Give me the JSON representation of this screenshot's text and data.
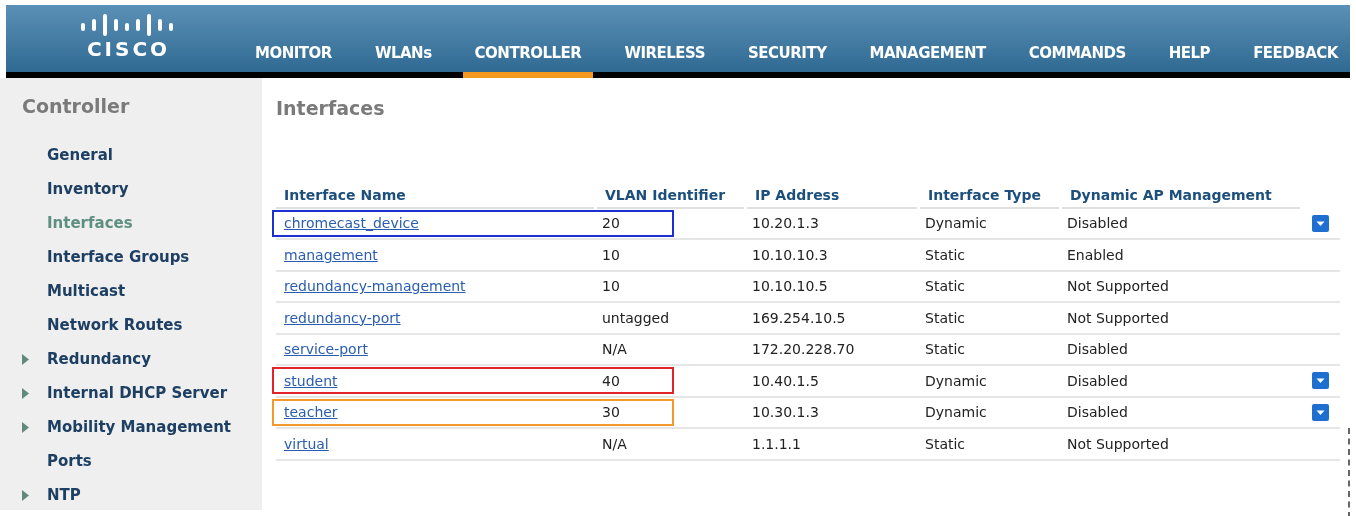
{
  "brand": {
    "name": "CISCO"
  },
  "nav": [
    {
      "label": "MONITOR",
      "selected": false
    },
    {
      "label": "WLANs",
      "selected": false
    },
    {
      "label": "CONTROLLER",
      "selected": true
    },
    {
      "label": "WIRELESS",
      "selected": false
    },
    {
      "label": "SECURITY",
      "selected": false
    },
    {
      "label": "MANAGEMENT",
      "selected": false
    },
    {
      "label": "COMMANDS",
      "selected": false
    },
    {
      "label": "HELP",
      "selected": false
    },
    {
      "label": "FEEDBACK",
      "selected": false
    }
  ],
  "sidebar": {
    "title": "Controller",
    "items": [
      {
        "label": "General",
        "expandable": false,
        "selected": false
      },
      {
        "label": "Inventory",
        "expandable": false,
        "selected": false
      },
      {
        "label": "Interfaces",
        "expandable": false,
        "selected": true
      },
      {
        "label": "Interface Groups",
        "expandable": false,
        "selected": false
      },
      {
        "label": "Multicast",
        "expandable": false,
        "selected": false
      },
      {
        "label": "Network Routes",
        "expandable": false,
        "selected": false
      },
      {
        "label": "Redundancy",
        "expandable": true,
        "selected": false
      },
      {
        "label": "Internal DHCP Server",
        "expandable": true,
        "selected": false
      },
      {
        "label": "Mobility Management",
        "expandable": true,
        "selected": false
      },
      {
        "label": "Ports",
        "expandable": false,
        "selected": false
      },
      {
        "label": "NTP",
        "expandable": true,
        "selected": false
      }
    ]
  },
  "page_title": "Interfaces",
  "table": {
    "columns": [
      "Interface Name",
      "VLAN Identifier",
      "IP Address",
      "Interface Type",
      "Dynamic AP Management"
    ],
    "rows": [
      {
        "cells": [
          "chromecast_device",
          "20",
          "10.20.1.3",
          "Dynamic",
          "Disabled"
        ],
        "menu": true,
        "color": "#1d2fd0"
      },
      {
        "cells": [
          "management",
          "10",
          "10.10.10.3",
          "Static",
          "Enabled"
        ],
        "menu": false
      },
      {
        "cells": [
          "redundancy-management",
          "10",
          "10.10.10.5",
          "Static",
          "Not Supported"
        ],
        "menu": false
      },
      {
        "cells": [
          "redundancy-port",
          "untagged",
          "169.254.10.5",
          "Static",
          "Not Supported"
        ],
        "menu": false
      },
      {
        "cells": [
          "service-port",
          "N/A",
          "172.20.228.70",
          "Static",
          "Disabled"
        ],
        "menu": false
      },
      {
        "cells": [
          "student",
          "40",
          "10.40.1.5",
          "Dynamic",
          "Disabled"
        ],
        "menu": true,
        "color": "#e0242a"
      },
      {
        "cells": [
          "teacher",
          "30",
          "10.30.1.3",
          "Dynamic",
          "Disabled"
        ],
        "menu": true,
        "color": "#f39a2b"
      },
      {
        "cells": [
          "virtual",
          "N/A",
          "1.1.1.1",
          "Static",
          "Not Supported"
        ],
        "menu": false
      }
    ]
  }
}
